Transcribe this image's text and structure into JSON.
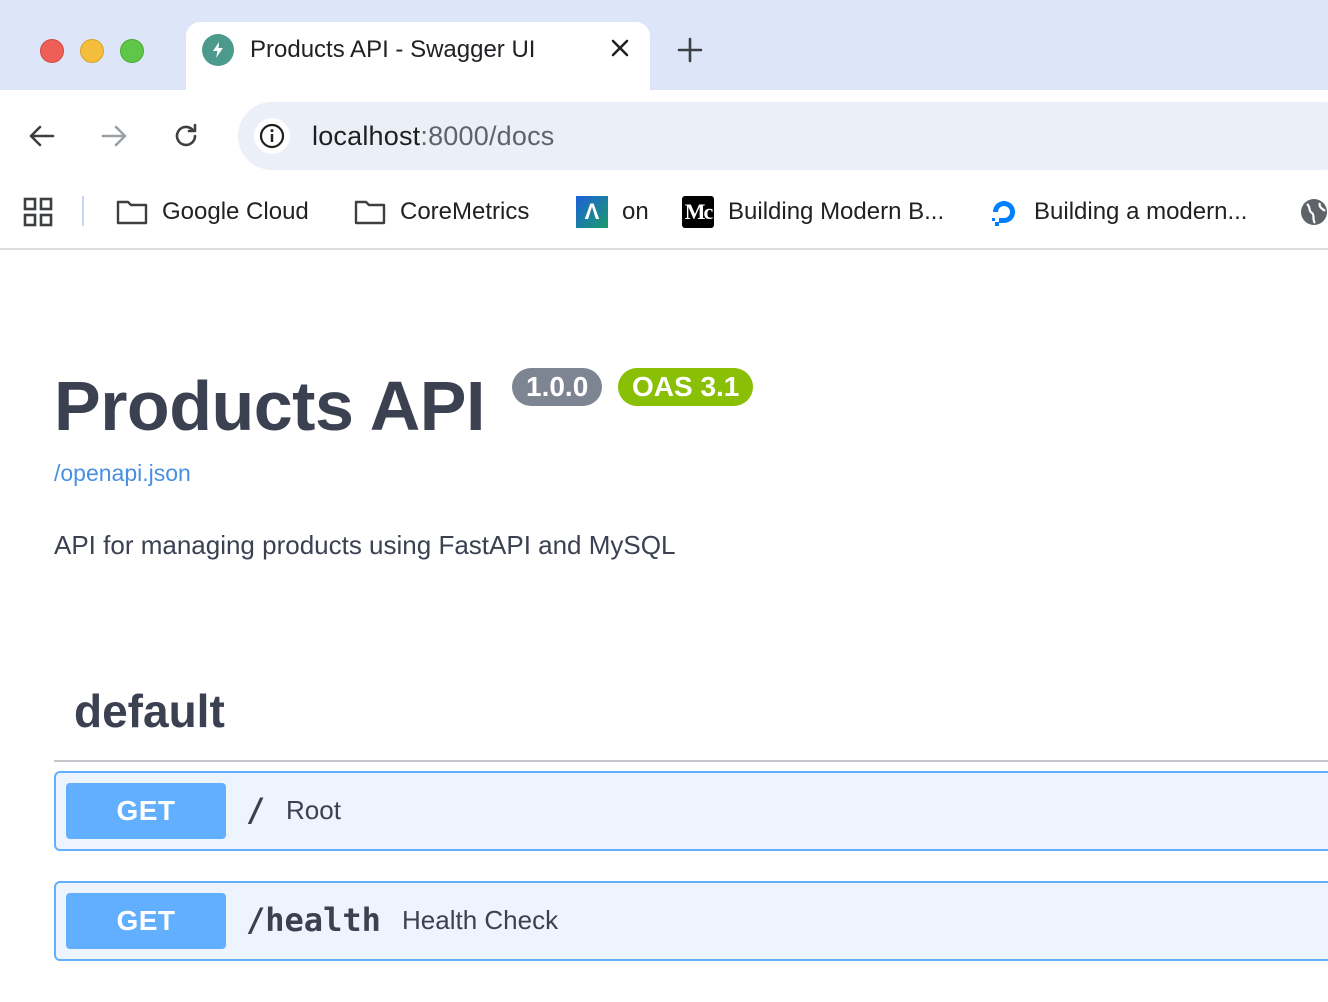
{
  "browser": {
    "tab": {
      "title": "Products API - Swagger UI",
      "favicon": "fastapi-logo-icon"
    },
    "url": {
      "host": "localhost",
      "rest": ":8000/docs"
    },
    "bookmarks": [
      {
        "label": "Google Cloud",
        "icon": "folder-icon"
      },
      {
        "label": "CoreMetrics",
        "icon": "folder-icon"
      },
      {
        "label": "on",
        "icon": "a-logo-icon"
      },
      {
        "label": "Building Modern B...",
        "icon": "medium-logo-icon"
      },
      {
        "label": "Building a modern...",
        "icon": "digitalocean-logo-icon"
      }
    ],
    "medium_icon_text": "Mc",
    "a_icon_text": "Λ"
  },
  "swagger": {
    "title": "Products API",
    "version": "1.0.0",
    "oas": "OAS 3.1",
    "spec_link": "/openapi.json",
    "description": "API for managing products using FastAPI and MySQL",
    "tag": "default",
    "operations": [
      {
        "method": "GET",
        "path": "/",
        "summary": "Root"
      },
      {
        "method": "GET",
        "path": "/health",
        "summary": "Health Check"
      }
    ]
  },
  "colors": {
    "get_method": "#61affe",
    "oas_badge": "#89bf04",
    "version_badge": "#7d8492",
    "link": "#4990e2",
    "tab_strip": "#dde6f8"
  }
}
